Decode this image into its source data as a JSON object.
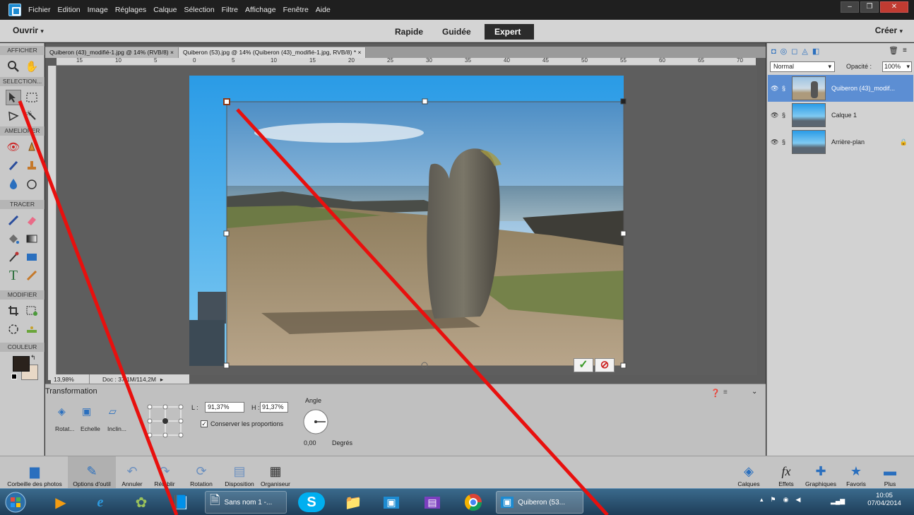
{
  "menubar": {
    "items": [
      "Fichier",
      "Edition",
      "Image",
      "Réglages",
      "Calque",
      "Sélection",
      "Filtre",
      "Affichage",
      "Fenêtre",
      "Aide"
    ],
    "controls": [
      "–",
      "❐",
      "✕"
    ]
  },
  "modebar": {
    "open": "Ouvrir",
    "create": "Créer",
    "tabs": [
      "Rapide",
      "Guidée",
      "Expert"
    ]
  },
  "toolbox": {
    "sections": [
      "AFFICHER",
      "SELECTION...",
      "AMELIORER",
      "TRACER",
      "MODIFIER",
      "COULEUR"
    ]
  },
  "docs": {
    "tabs": [
      "Quiberon (43)_modifié-1.jpg @ 14% (RVB/8) ×",
      "Quiberon (53).jpg @ 14% (Quiberon (43)_modifié-1.jpg, RVB/8) * ×"
    ],
    "ruler_labels": [
      "15",
      "10",
      "5",
      "0",
      "5",
      "10",
      "15",
      "20",
      "25",
      "30",
      "35",
      "40",
      "45",
      "50",
      "55",
      "60",
      "65",
      "70"
    ],
    "zoom": "13,98%",
    "doc_size": "Doc : 37,1M/114,2M"
  },
  "options": {
    "title": "Transformation",
    "modes": [
      "Rotat...",
      "Echelle",
      "Inclin..."
    ],
    "width_label": "L :",
    "width_value": "91,37%",
    "height_label": "H :",
    "height_value": "91,37%",
    "keep_proportions": "Conserver les proportions",
    "angle_label": "Angle",
    "angle_value": "0,00",
    "angle_unit": "Degrés"
  },
  "layers": {
    "blend_mode": "Normal",
    "opacity_label": "Opacité :",
    "opacity_value": "100%",
    "items": [
      "Quiberon (43)_modif...",
      "Calque 1",
      "Arrière-plan"
    ]
  },
  "bottombar": {
    "left": [
      "Corbeille des photos",
      "Options d'outil",
      "Annuler",
      "Rétablir",
      "Rotation",
      "Disposition",
      "Organiseur"
    ],
    "right": [
      "Calques",
      "Effets",
      "Graphiques",
      "Favoris",
      "Plus"
    ]
  },
  "taskbar": {
    "windows": [
      "Sans nom 1 -...",
      "Quiberon (53..."
    ],
    "time": "10:05",
    "date": "07/04/2014"
  },
  "colors": {
    "accent": "#5c8ed3",
    "annotation": "#e8100e"
  }
}
